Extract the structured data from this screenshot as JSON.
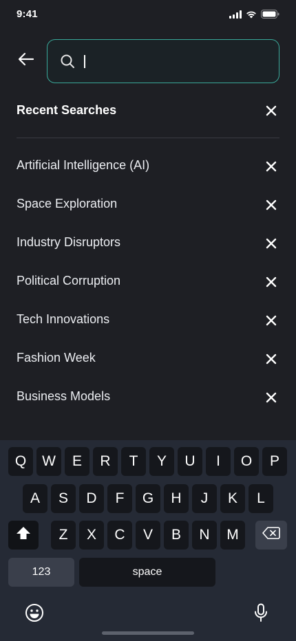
{
  "status_bar": {
    "time": "9:41"
  },
  "search": {
    "value": "",
    "placeholder": ""
  },
  "recent": {
    "title": "Recent Searches",
    "items": [
      {
        "label": "Artificial Intelligence (AI)"
      },
      {
        "label": "Space Exploration"
      },
      {
        "label": "Industry Disruptors"
      },
      {
        "label": "Political Corruption"
      },
      {
        "label": "Tech Innovations"
      },
      {
        "label": "Fashion Week"
      },
      {
        "label": "Business Models"
      }
    ]
  },
  "keyboard": {
    "row1": [
      "Q",
      "W",
      "E",
      "R",
      "T",
      "Y",
      "U",
      "I",
      "O",
      "P"
    ],
    "row2": [
      "A",
      "S",
      "D",
      "F",
      "G",
      "H",
      "J",
      "K",
      "L"
    ],
    "row3": [
      "Z",
      "X",
      "C",
      "V",
      "B",
      "N",
      "M"
    ],
    "numbers_label": "123",
    "space_label": "space"
  },
  "colors": {
    "background": "#1e1f24",
    "accent": "#3aa99a",
    "keyboard": "#252a35",
    "key": "#15171c"
  },
  "icons": [
    "back-arrow-icon",
    "search-icon",
    "close-icon",
    "shift-icon",
    "backspace-icon",
    "emoji-icon",
    "microphone-icon",
    "signal-icon",
    "wifi-icon",
    "battery-icon"
  ]
}
